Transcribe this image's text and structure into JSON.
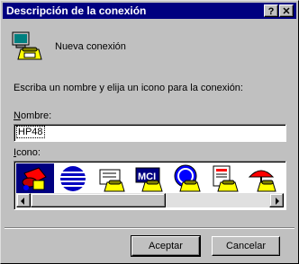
{
  "window": {
    "title": "Descripción de la conexión",
    "help_button": "?",
    "close_button": "✕"
  },
  "connection": {
    "name": "Nueva conexión",
    "icon": "phone-computer-icon"
  },
  "instruction": "Escriba un nombre y elija un icono para la conexión:",
  "name_field": {
    "label_accel": "N",
    "label_rest": "ombre:",
    "value": "HP48"
  },
  "icon_field": {
    "label_accel": "I",
    "label_rest": "cono:",
    "icons": [
      {
        "name": "red-phone-icon",
        "selected": true
      },
      {
        "name": "globe-stripes-icon",
        "selected": false
      },
      {
        "name": "fax-phone-icon",
        "selected": false
      },
      {
        "name": "mci-logo-icon",
        "selected": false
      },
      {
        "name": "ge-logo-icon",
        "selected": false
      },
      {
        "name": "document-phone-icon",
        "selected": false
      },
      {
        "name": "umbrella-phone-icon",
        "selected": false
      }
    ],
    "mci_text": "MCI"
  },
  "buttons": {
    "ok": "Aceptar",
    "cancel": "Cancelar"
  },
  "colors": {
    "titlebar": "#000080",
    "face": "#c0c0c0",
    "selection": "#000080"
  }
}
